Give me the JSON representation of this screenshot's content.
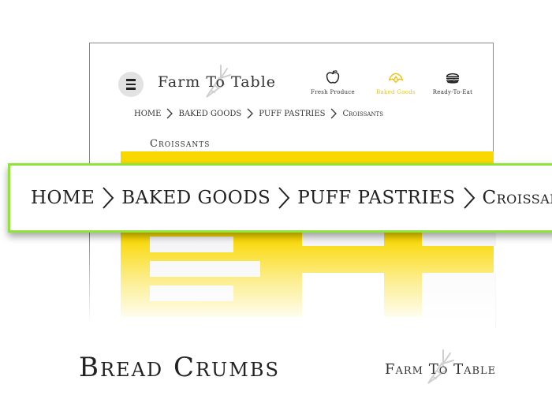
{
  "brand": {
    "name": "Farm To Table"
  },
  "nav": [
    {
      "label": "Fresh Produce",
      "icon": "apple-icon",
      "active": false
    },
    {
      "label": "Baked Goods",
      "icon": "croissant-icon",
      "active": true
    },
    {
      "label": "Ready-To-Eat",
      "icon": "burger-icon",
      "active": false
    }
  ],
  "breadcrumb": [
    "HOME",
    "BAKED GOODS",
    "PUFF PASTRIES",
    "Croissants"
  ],
  "section": {
    "title": "Croissants"
  },
  "caption": {
    "title": "Bread Crumbs",
    "brand": "Farm To Table"
  },
  "colors": {
    "accent": "#f9d800",
    "active_nav": "#f2c318",
    "highlight_border": "#8fe33b",
    "placeholder": "#f4f4f7"
  }
}
